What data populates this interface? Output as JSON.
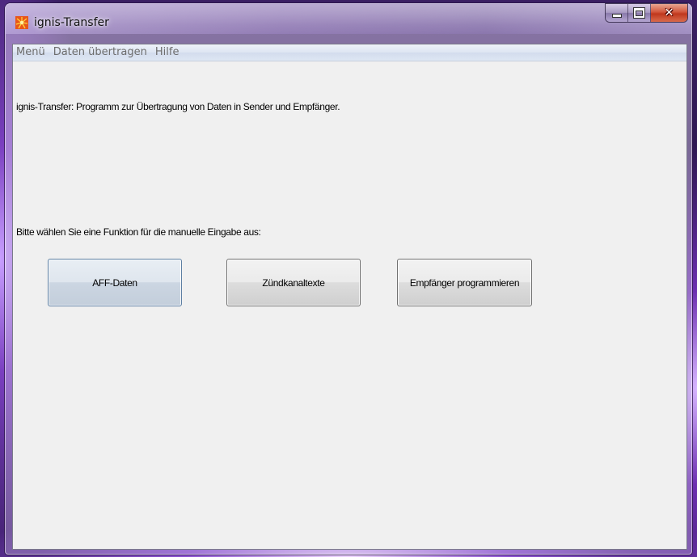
{
  "window": {
    "title": "ignis-Transfer",
    "app_icon": "ignis-sunburst-icon",
    "controls": {
      "minimize": "minimize-icon",
      "maximize": "maximize-icon",
      "close": "close-icon"
    }
  },
  "menubar": {
    "items": [
      {
        "label": "Menü"
      },
      {
        "label": "Daten übertragen"
      },
      {
        "label": "Hilfe"
      }
    ]
  },
  "main": {
    "intro": "ignis-Transfer: Programm zur Übertragung von Daten in Sender und Empfänger.",
    "prompt": "Bitte wählen Sie eine Funktion für die manuelle Eingabe aus:",
    "buttons": [
      {
        "label": "AFF-Daten"
      },
      {
        "label": "Zündkanaltexte"
      },
      {
        "label": "Empfänger programmieren"
      }
    ]
  },
  "colors": {
    "client_background": "#f0f0f0",
    "close_button": "#c0381d"
  }
}
